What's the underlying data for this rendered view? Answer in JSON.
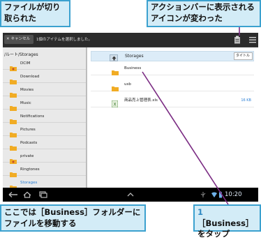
{
  "annotations": {
    "top_left": "ファイルが切り取られた",
    "top_right": "アクションバーに表示されるアイコンが変わった",
    "bottom_left": "ここでは［Business］フォルダーにファイルを移動する",
    "bottom_right_step": "1",
    "bottom_right": "［Business］をタップ"
  },
  "action_bar": {
    "cancel_label": "キャンセル",
    "cancel_icon": "close-icon",
    "selected_text": "1個のアイテムを選択しました。"
  },
  "left_pane": {
    "breadcrumb": "/ルート/Storages",
    "items": [
      {
        "label": "DCIM",
        "icon": "folder-starred"
      },
      {
        "label": "Download",
        "icon": "folder"
      },
      {
        "label": "Movies",
        "icon": "folder"
      },
      {
        "label": "Music",
        "icon": "folder"
      },
      {
        "label": "Notifications",
        "icon": "folder"
      },
      {
        "label": "Pictures",
        "icon": "folder"
      },
      {
        "label": "Podcasts",
        "icon": "folder"
      },
      {
        "label": "private",
        "icon": "folder-starred"
      },
      {
        "label": "Ringtones",
        "icon": "folder"
      },
      {
        "label": "Storages",
        "icon": "folder",
        "active": true
      }
    ]
  },
  "right_pane": {
    "path_label": "Storages",
    "sort_label": "タイトル",
    "files": [
      {
        "label": "Business",
        "size": "",
        "icon": "folder"
      },
      {
        "label": "usb",
        "size": "",
        "icon": "folder"
      },
      {
        "label": "商品売上管理表.xls",
        "size": "16 KB",
        "icon": "spreadsheet"
      }
    ]
  },
  "status": {
    "time": "10:20"
  },
  "colors": {
    "callout_bg": "#d3ecf7",
    "callout_border": "#3ba1cf",
    "pointer": "#7b2c83",
    "folder": "#f1ac24",
    "accent": "#2a7fd5"
  }
}
